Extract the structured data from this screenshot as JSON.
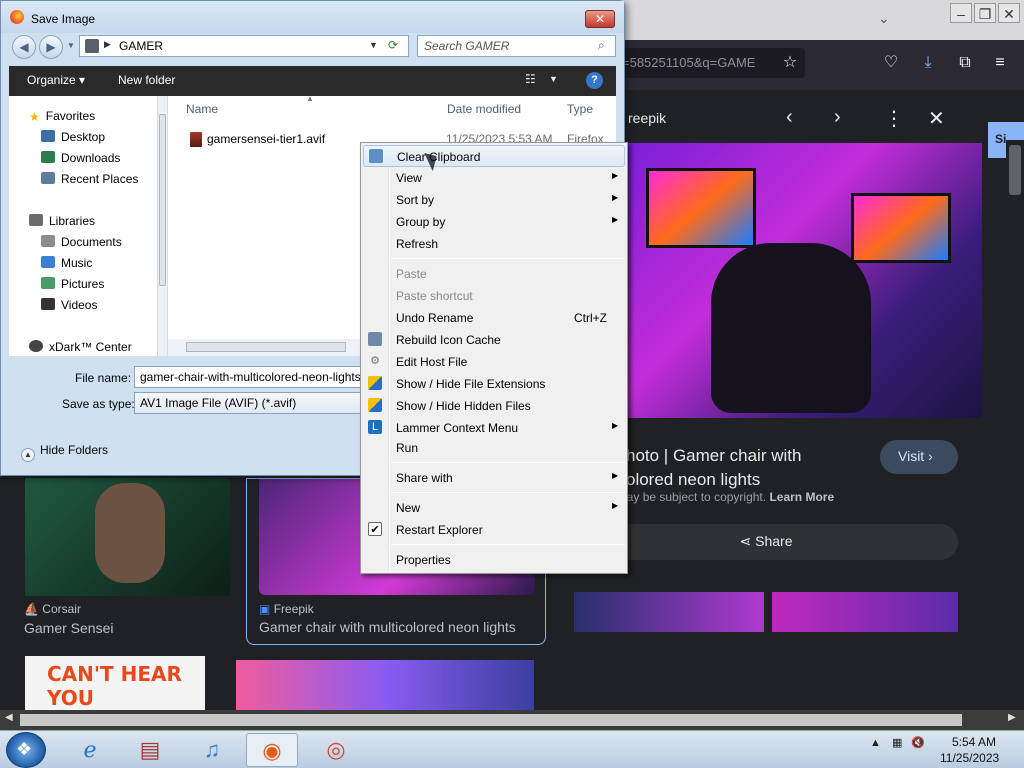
{
  "browser": {
    "url_fragment": "=585251105&q=GAME",
    "preview": {
      "source": "reepik",
      "title_line1": "hoto | Gamer chair with",
      "title_line2": "olored neon lights",
      "visit_label": "Visit",
      "copyright_text": "Images may be subject to copyright.",
      "learn_more": "Learn More",
      "share_label": "Share"
    },
    "results": [
      {
        "source": "Corsair",
        "title": "Gamer Sensei"
      },
      {
        "source": "Freepik",
        "title": "Gamer chair with multicolored neon lights"
      }
    ],
    "thumb_text": "CAN'T HEAR YOU"
  },
  "dialog": {
    "title": "Save Image",
    "address": "GAMER",
    "search_placeholder": "Search GAMER",
    "toolbar": {
      "organize": "Organize",
      "new_folder": "New folder"
    },
    "nav": {
      "favorites": "Favorites",
      "favorites_items": [
        "Desktop",
        "Downloads",
        "Recent Places"
      ],
      "libraries": "Libraries",
      "libraries_items": [
        "Documents",
        "Music",
        "Pictures",
        "Videos"
      ],
      "xdark": "xDark™ Center"
    },
    "columns": {
      "name": "Name",
      "date": "Date modified",
      "type": "Type"
    },
    "file": {
      "name": "gamersensei-tier1.avif",
      "date": "11/25/2023 5:53 AM",
      "type": "Firefox HT"
    },
    "file_name_label": "File name:",
    "file_name_value": "gamer-chair-with-multicolored-neon-lights",
    "save_type_label": "Save as type:",
    "save_type_value": "AV1 Image File (AVIF) (*.avif)",
    "hide_folders": "Hide Folders"
  },
  "context_menu": {
    "items": [
      {
        "label": "Clear Clipboard"
      },
      {
        "label": "View"
      },
      {
        "label": "Sort by"
      },
      {
        "label": "Group by"
      },
      {
        "label": "Refresh"
      },
      {
        "label": "Paste"
      },
      {
        "label": "Paste shortcut"
      },
      {
        "label": "Undo Rename",
        "shortcut": "Ctrl+Z"
      },
      {
        "label": "Rebuild Icon Cache"
      },
      {
        "label": "Edit Host File"
      },
      {
        "label": "Show / Hide File Extensions"
      },
      {
        "label": "Show / Hide Hidden Files"
      },
      {
        "label": "Lammer Context Menu"
      },
      {
        "label": "Run"
      },
      {
        "label": "Share with"
      },
      {
        "label": "New"
      },
      {
        "label": "Restart Explorer"
      },
      {
        "label": "Properties"
      }
    ]
  },
  "taskbar": {
    "time": "5:54 AM",
    "date": "11/25/2023"
  }
}
